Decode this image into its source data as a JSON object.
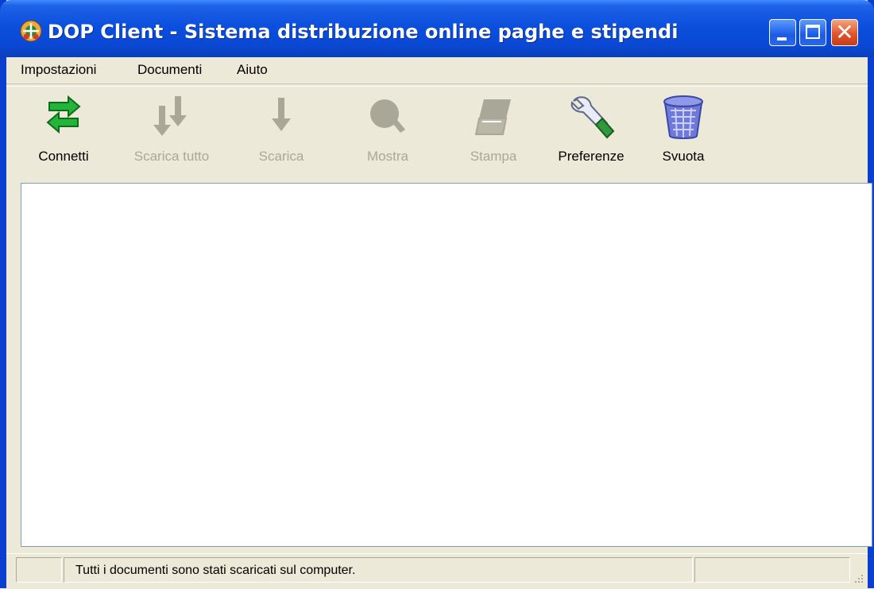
{
  "window": {
    "title": "DOP Client - Sistema distribuzione online paghe e stipendi",
    "app_icon": "dop-client-logo-icon",
    "controls": [
      "minimize-icon",
      "maximize-icon",
      "close-icon"
    ],
    "accent_color": "#0a48d4"
  },
  "menu": {
    "items": [
      {
        "label": "Impostazioni"
      },
      {
        "label": "Documenti"
      },
      {
        "label": "Aiuto"
      }
    ]
  },
  "toolbar": {
    "buttons": [
      {
        "label": "Connetti",
        "icon": "connect-arrows-icon",
        "enabled": true
      },
      {
        "label": "Scarica tutto",
        "icon": "download-all-icon",
        "enabled": false
      },
      {
        "label": "Scarica",
        "icon": "download-icon",
        "enabled": false
      },
      {
        "label": "Mostra",
        "icon": "magnifier-icon",
        "enabled": false
      },
      {
        "label": "Stampa",
        "icon": "print-icon",
        "enabled": false
      },
      {
        "label": "Preferenze",
        "icon": "wrench-icon",
        "enabled": true
      },
      {
        "label": "Svuota",
        "icon": "trash-bin-icon",
        "enabled": true
      }
    ]
  },
  "document_list": {
    "items": []
  },
  "statusbar": {
    "message": "Tutti i documenti sono stati scaricati sul computer."
  }
}
